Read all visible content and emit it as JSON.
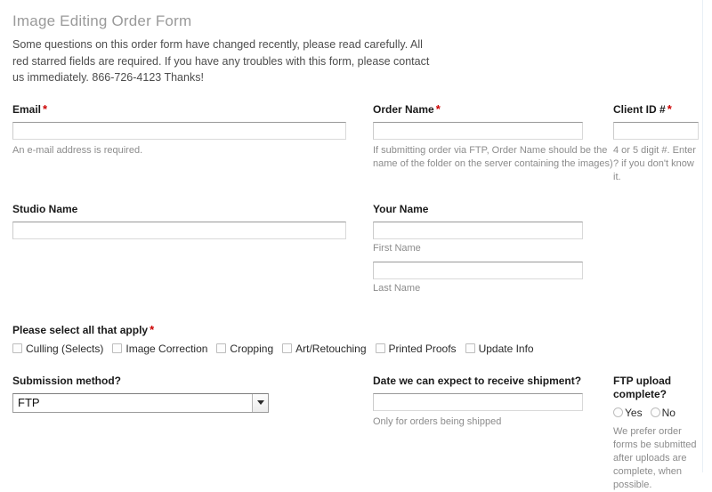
{
  "form": {
    "title": "Image Editing Order Form",
    "intro": "Some questions on this order form have changed recently, please read carefully. All red starred fields are required. If you have any troubles with this form, please contact us immediately. 866-726-4123 Thanks!",
    "required_marker": "*",
    "required_color": "#cc0000"
  },
  "fields": {
    "email": {
      "label": "Email",
      "required": true,
      "value": "",
      "placeholder": "",
      "hint": "An e-mail address is required."
    },
    "order_name": {
      "label": "Order Name",
      "required": true,
      "value": "",
      "placeholder": "",
      "hint": "If submitting order via FTP, Order Name should be the name of the folder on the server containing the images)"
    },
    "client_id": {
      "label": "Client ID #",
      "required": true,
      "value": "",
      "placeholder": "",
      "hint": "4 or 5 digit #. Enter ? if you don't know it."
    },
    "studio_name": {
      "label": "Studio Name",
      "required": false,
      "value": "",
      "placeholder": ""
    },
    "your_name": {
      "label": "Your Name",
      "required": false,
      "first": {
        "value": "",
        "placeholder": "",
        "sublabel": "First Name"
      },
      "last": {
        "value": "",
        "placeholder": "",
        "sublabel": "Last Name"
      }
    },
    "services": {
      "label": "Please select all that apply",
      "required": true,
      "options": [
        {
          "label": "Culling (Selects)",
          "checked": false
        },
        {
          "label": "Image Correction",
          "checked": false
        },
        {
          "label": "Cropping",
          "checked": false
        },
        {
          "label": "Art/Retouching",
          "checked": false
        },
        {
          "label": "Printed Proofs",
          "checked": false
        },
        {
          "label": "Update Info",
          "checked": false
        }
      ]
    },
    "submission_method": {
      "label": "Submission method?",
      "required": false,
      "selected": "FTP"
    },
    "shipment_date": {
      "label": "Date we can expect to receive shipment?",
      "required": false,
      "value": "",
      "placeholder": "",
      "hint": "Only for orders being shipped"
    },
    "ftp_upload_complete": {
      "label": "FTP upload complete?",
      "required": false,
      "options": [
        {
          "label": "Yes",
          "checked": false
        },
        {
          "label": "No",
          "checked": false
        }
      ],
      "hint": "We prefer order forms be submitted after uploads are complete, when possible."
    }
  }
}
